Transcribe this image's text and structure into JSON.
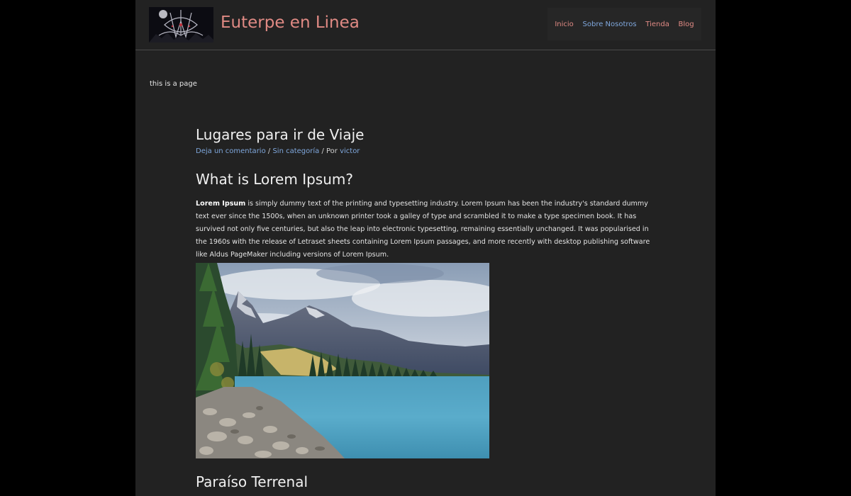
{
  "header": {
    "site_title": "Euterpe en Linea",
    "logo_icon": "gothic-logo-icon",
    "nav": [
      {
        "label": "Inicio",
        "color": "#e08a84"
      },
      {
        "label": "Sobre Nosotros",
        "color": "#7fa7dc"
      },
      {
        "label": "Tienda",
        "color": "#e08a84"
      },
      {
        "label": "Blog",
        "color": "#e08a84"
      }
    ]
  },
  "page_note": "this is a page",
  "post": {
    "title": "Lugares para ir de Viaje",
    "meta": {
      "comment_link": "Deja un comentario",
      "separator": " / ",
      "category_link": "Sin categoría",
      "author_prefix": " / Por ",
      "author_link": "victor"
    },
    "heading": "What is Lorem Ipsum?",
    "paragraph_bold": "Lorem Ipsum",
    "paragraph_text": " is simply dummy text of the printing and typesetting industry. Lorem Ipsum has been the industry's standard dummy text ever since the 1500s, when an unknown printer took a galley of type and scrambled it to make a type specimen book. It has survived not only five centuries, but also the leap into electronic typesetting, remaining essentially unchanged. It was popularised in the 1960s with the release of Letraset sheets containing Lorem Ipsum passages, and more recently with desktop publishing software like Aldus PageMaker including versions of Lorem Ipsum.",
    "image_subject": "mountain-lake-photo",
    "subheading": "Paraíso Terrenal"
  },
  "colors": {
    "background": "#000000",
    "page": "#222222",
    "accent_pink": "#e08a84",
    "accent_blue": "#7fa7dc"
  }
}
